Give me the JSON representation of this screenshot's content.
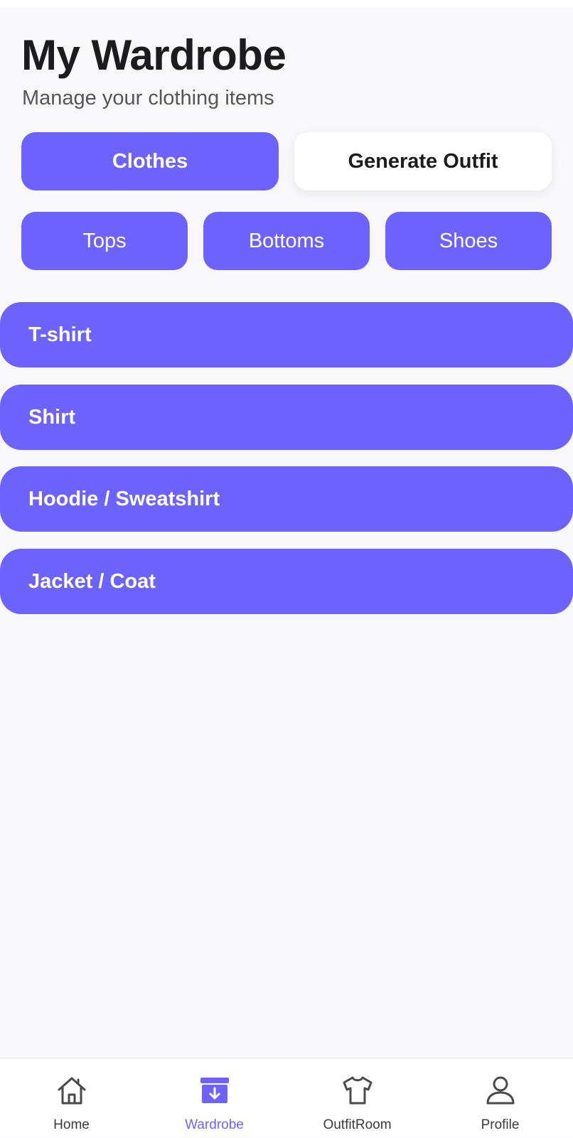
{
  "header": {
    "title": "My Wardrobe",
    "subtitle": "Manage your clothing items"
  },
  "mode_toggle": {
    "selected": "Clothes",
    "options": [
      "Clothes",
      "Generate Outfit"
    ]
  },
  "category_filters": {
    "items": [
      "Tops",
      "Bottoms",
      "Shoes"
    ]
  },
  "clothing_list": {
    "items": [
      "T-shirt",
      "Shirt",
      "Hoodie / Sweatshirt",
      "Jacket / Coat"
    ]
  },
  "tabbar": {
    "active": "Wardrobe",
    "tabs": [
      {
        "label": "Home",
        "icon": "home-icon"
      },
      {
        "label": "Wardrobe",
        "icon": "wardrobe-archive-icon"
      },
      {
        "label": "OutfitRoom",
        "icon": "tshirt-icon"
      },
      {
        "label": "Profile",
        "icon": "person-icon"
      }
    ]
  },
  "colors": {
    "accent": "#6c63ff",
    "background": "#f8f8fa",
    "text_primary": "#1c1c1e",
    "text_secondary": "#55555a"
  }
}
